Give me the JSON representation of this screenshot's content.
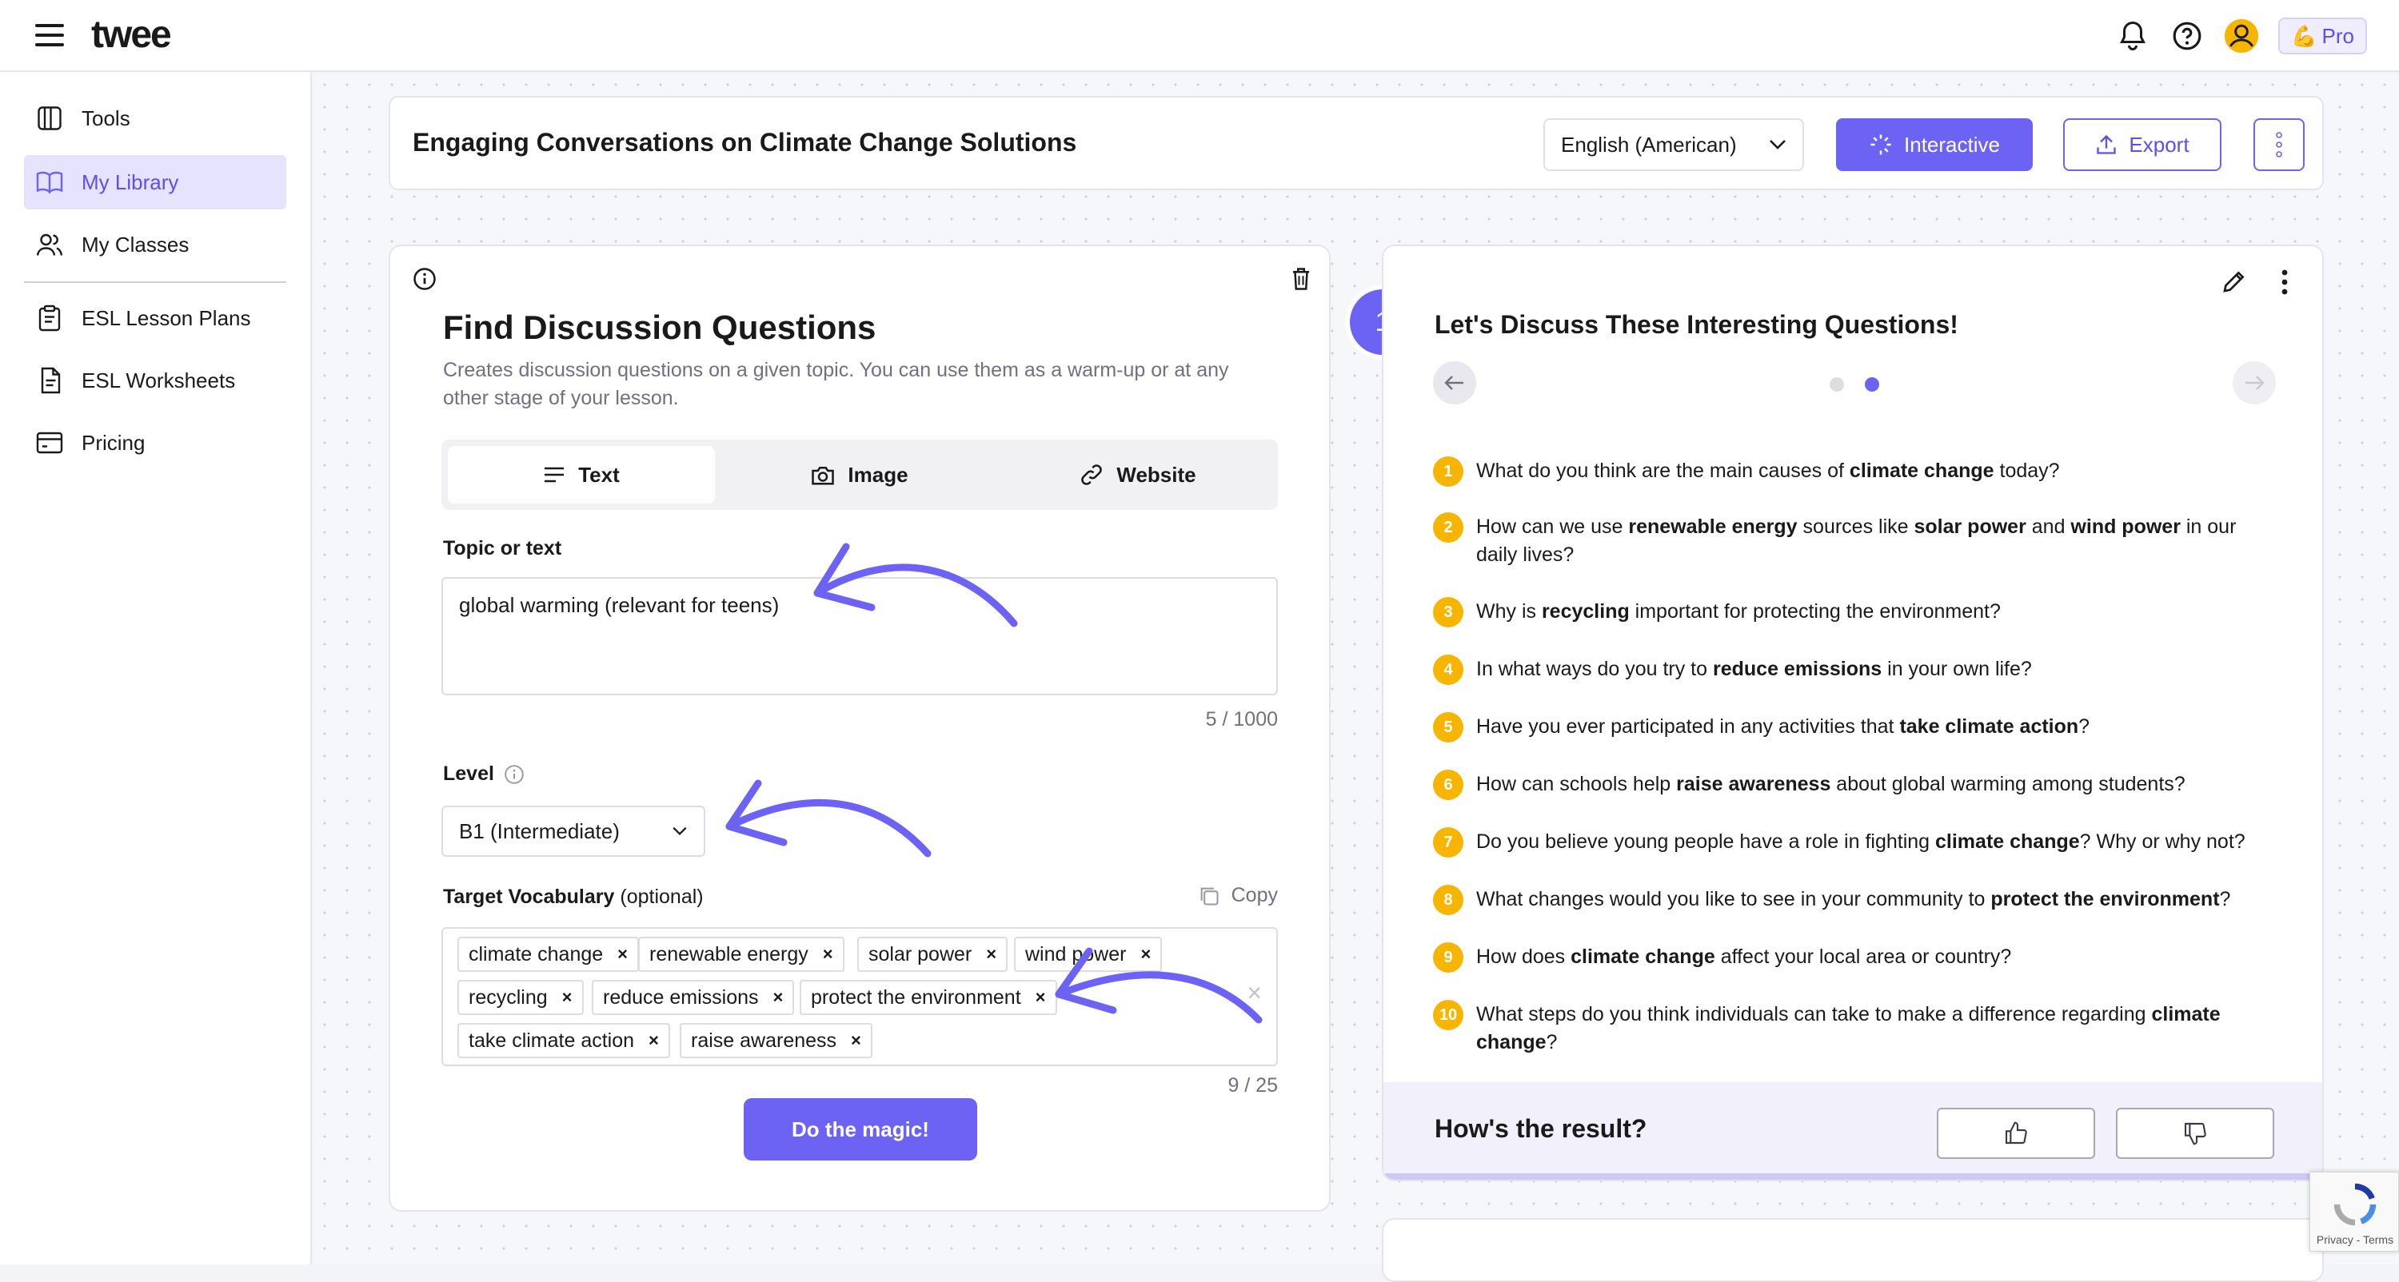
{
  "app": {
    "logo": "twee",
    "pro_label": "Pro"
  },
  "colors": {
    "accent": "#6c63f5",
    "number_badge": "#f7b500",
    "annotation_arrow": "#6c63f5"
  },
  "sidebar": {
    "items": [
      {
        "label": "Tools",
        "icon": "tools-icon",
        "active": false
      },
      {
        "label": "My Library",
        "icon": "book-icon",
        "active": true
      },
      {
        "label": "My Classes",
        "icon": "users-icon",
        "active": false
      },
      {
        "label": "ESL Lesson Plans",
        "icon": "clipboard-icon",
        "active": false
      },
      {
        "label": "ESL Worksheets",
        "icon": "document-icon",
        "active": false
      },
      {
        "label": "Pricing",
        "icon": "card-icon",
        "active": false
      }
    ]
  },
  "header": {
    "title": "Engaging Conversations on Climate Change Solutions",
    "language": "English (American)",
    "interactive_label": "Interactive",
    "export_label": "Export"
  },
  "form": {
    "title": "Find Discussion Questions",
    "description": "Creates discussion questions on a given topic. You can use them as a warm-up or at any other stage of your lesson.",
    "tabs": [
      {
        "label": "Text",
        "icon": "lines-icon",
        "active": true
      },
      {
        "label": "Image",
        "icon": "camera-icon",
        "active": false
      },
      {
        "label": "Website",
        "icon": "link-icon",
        "active": false
      }
    ],
    "topic_label": "Topic or text",
    "topic_value": "global warming (relevant for teens)",
    "topic_counter": "5 / 1000",
    "level_label": "Level",
    "level_value": "B1 (Intermediate)",
    "vocab_label": "Target Vocabulary",
    "vocab_optional": "(optional)",
    "copy_label": "Copy",
    "vocab_chips": [
      "climate change",
      "renewable energy",
      "solar power",
      "wind power",
      "recycling",
      "reduce emissions",
      "protect the environment",
      "take climate action",
      "raise awareness"
    ],
    "vocab_counter": "9 / 25",
    "submit_label": "Do the magic!"
  },
  "result": {
    "step": "1",
    "title": "Let's Discuss These Interesting Questions!",
    "page_count": 2,
    "active_page": 2,
    "questions": [
      {
        "num": "1",
        "pre": "What do you think are the main causes of ",
        "bold": "climate change",
        "post": " today?"
      },
      {
        "num": "2",
        "pre": "How can we use ",
        "bold": "renewable energy",
        "mid": " sources like ",
        "bold2": "solar power",
        "mid2": " and ",
        "bold3": "wind power",
        "post": " in our daily lives?"
      },
      {
        "num": "3",
        "pre": "Why is ",
        "bold": "recycling",
        "post": " important for protecting the environment?"
      },
      {
        "num": "4",
        "pre": "In what ways do you try to ",
        "bold": "reduce emissions",
        "post": " in your own life?"
      },
      {
        "num": "5",
        "pre": "Have you ever participated in any activities that ",
        "bold": "take climate action",
        "post": "?"
      },
      {
        "num": "6",
        "pre": "How can schools help ",
        "bold": "raise awareness",
        "post": " about global warming among students?"
      },
      {
        "num": "7",
        "pre": "Do you believe young people have a role in fighting ",
        "bold": "climate change",
        "post": "? Why or why not?"
      },
      {
        "num": "8",
        "pre": "What changes would you like to see in your community to ",
        "bold": "protect the environment",
        "post": "?"
      },
      {
        "num": "9",
        "pre": "How does ",
        "bold": "climate change",
        "post": " affect your local area or country?"
      },
      {
        "num": "10",
        "pre": "What steps do you think individuals can take to make a difference regarding ",
        "bold": "climate change",
        "post": "?"
      }
    ],
    "feedback_title": "How's the result?"
  },
  "recaptcha": {
    "footer": "Privacy - Terms"
  }
}
